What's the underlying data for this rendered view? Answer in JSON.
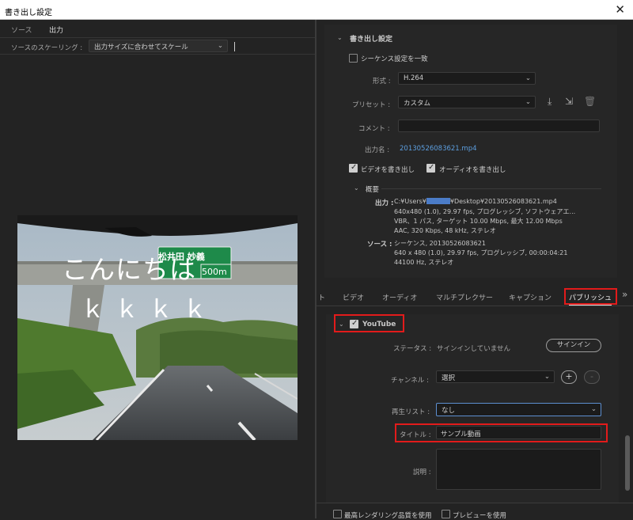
{
  "window": {
    "title": "書き出し設定",
    "close_glyph": "✕"
  },
  "left": {
    "tabs": [
      "ソース",
      "出力"
    ],
    "scaling_label": "ソースのスケーリング :",
    "scaling_value": "出力サイズに合わせてスケール",
    "overlay_line1": "こんにちは",
    "overlay_line2": "ｋｋｋｋ",
    "sign_text1": "松井田 妙義",
    "sign_text2": "500m"
  },
  "export": {
    "section_title": "書き出し設定",
    "match_sequence": "シーケンス設定を一致",
    "format_label": "形式 :",
    "format_value": "H.264",
    "preset_label": "プリセット :",
    "preset_value": "カスタム",
    "comment_label": "コメント :",
    "output_name_label": "出力名 :",
    "output_name_value": "20130526083621.mp4",
    "export_video": "ビデオを書き出し",
    "export_audio": "オーディオを書き出し",
    "summary_title": "概要",
    "output_label": "出力 :",
    "output_path_pre": "C:¥Users¥",
    "output_path_post": "¥Desktop¥20130526083621.mp4",
    "output_lines": [
      "640x480 (1.0), 29.97 fps, プログレッシブ, ソフトウェアエ...",
      "VBR、1 パス, ターゲット 10.00 Mbps, 最大 12.00 Mbps",
      "AAC, 320 Kbps, 48 kHz, ステレオ"
    ],
    "source_label": "ソース :",
    "source_lines": [
      "シーケンス, 20130526083621",
      "640 x 480 (1.0), 29.97 fps, プログレッシブ, 00:00:04:21",
      "44100  Hz, ステレオ"
    ]
  },
  "tabs": {
    "partial": "ト",
    "items": [
      "ビデオ",
      "オーディオ",
      "マルチプレクサー",
      "キャプション",
      "パブリッシュ"
    ],
    "more": "»"
  },
  "youtube": {
    "title": "YouTube",
    "status_label": "ステータス :",
    "status_value": "サインインしていません",
    "signin": "サインイン",
    "channel_label": "チャンネル :",
    "channel_value": "選択",
    "playlist_label": "再生リスト :",
    "playlist_value": "なし",
    "title_label": "タイトル :",
    "title_value": "サンプル動画",
    "desc_label": "説明 :",
    "plus": "+",
    "minus": "-"
  },
  "bottom": {
    "max_render": "最高レンダリング品質を使用",
    "use_preview": "プレビューを使用"
  },
  "colors": {
    "highlight": "#e21b1b",
    "link": "#5d9fe0",
    "background": "#232323"
  }
}
